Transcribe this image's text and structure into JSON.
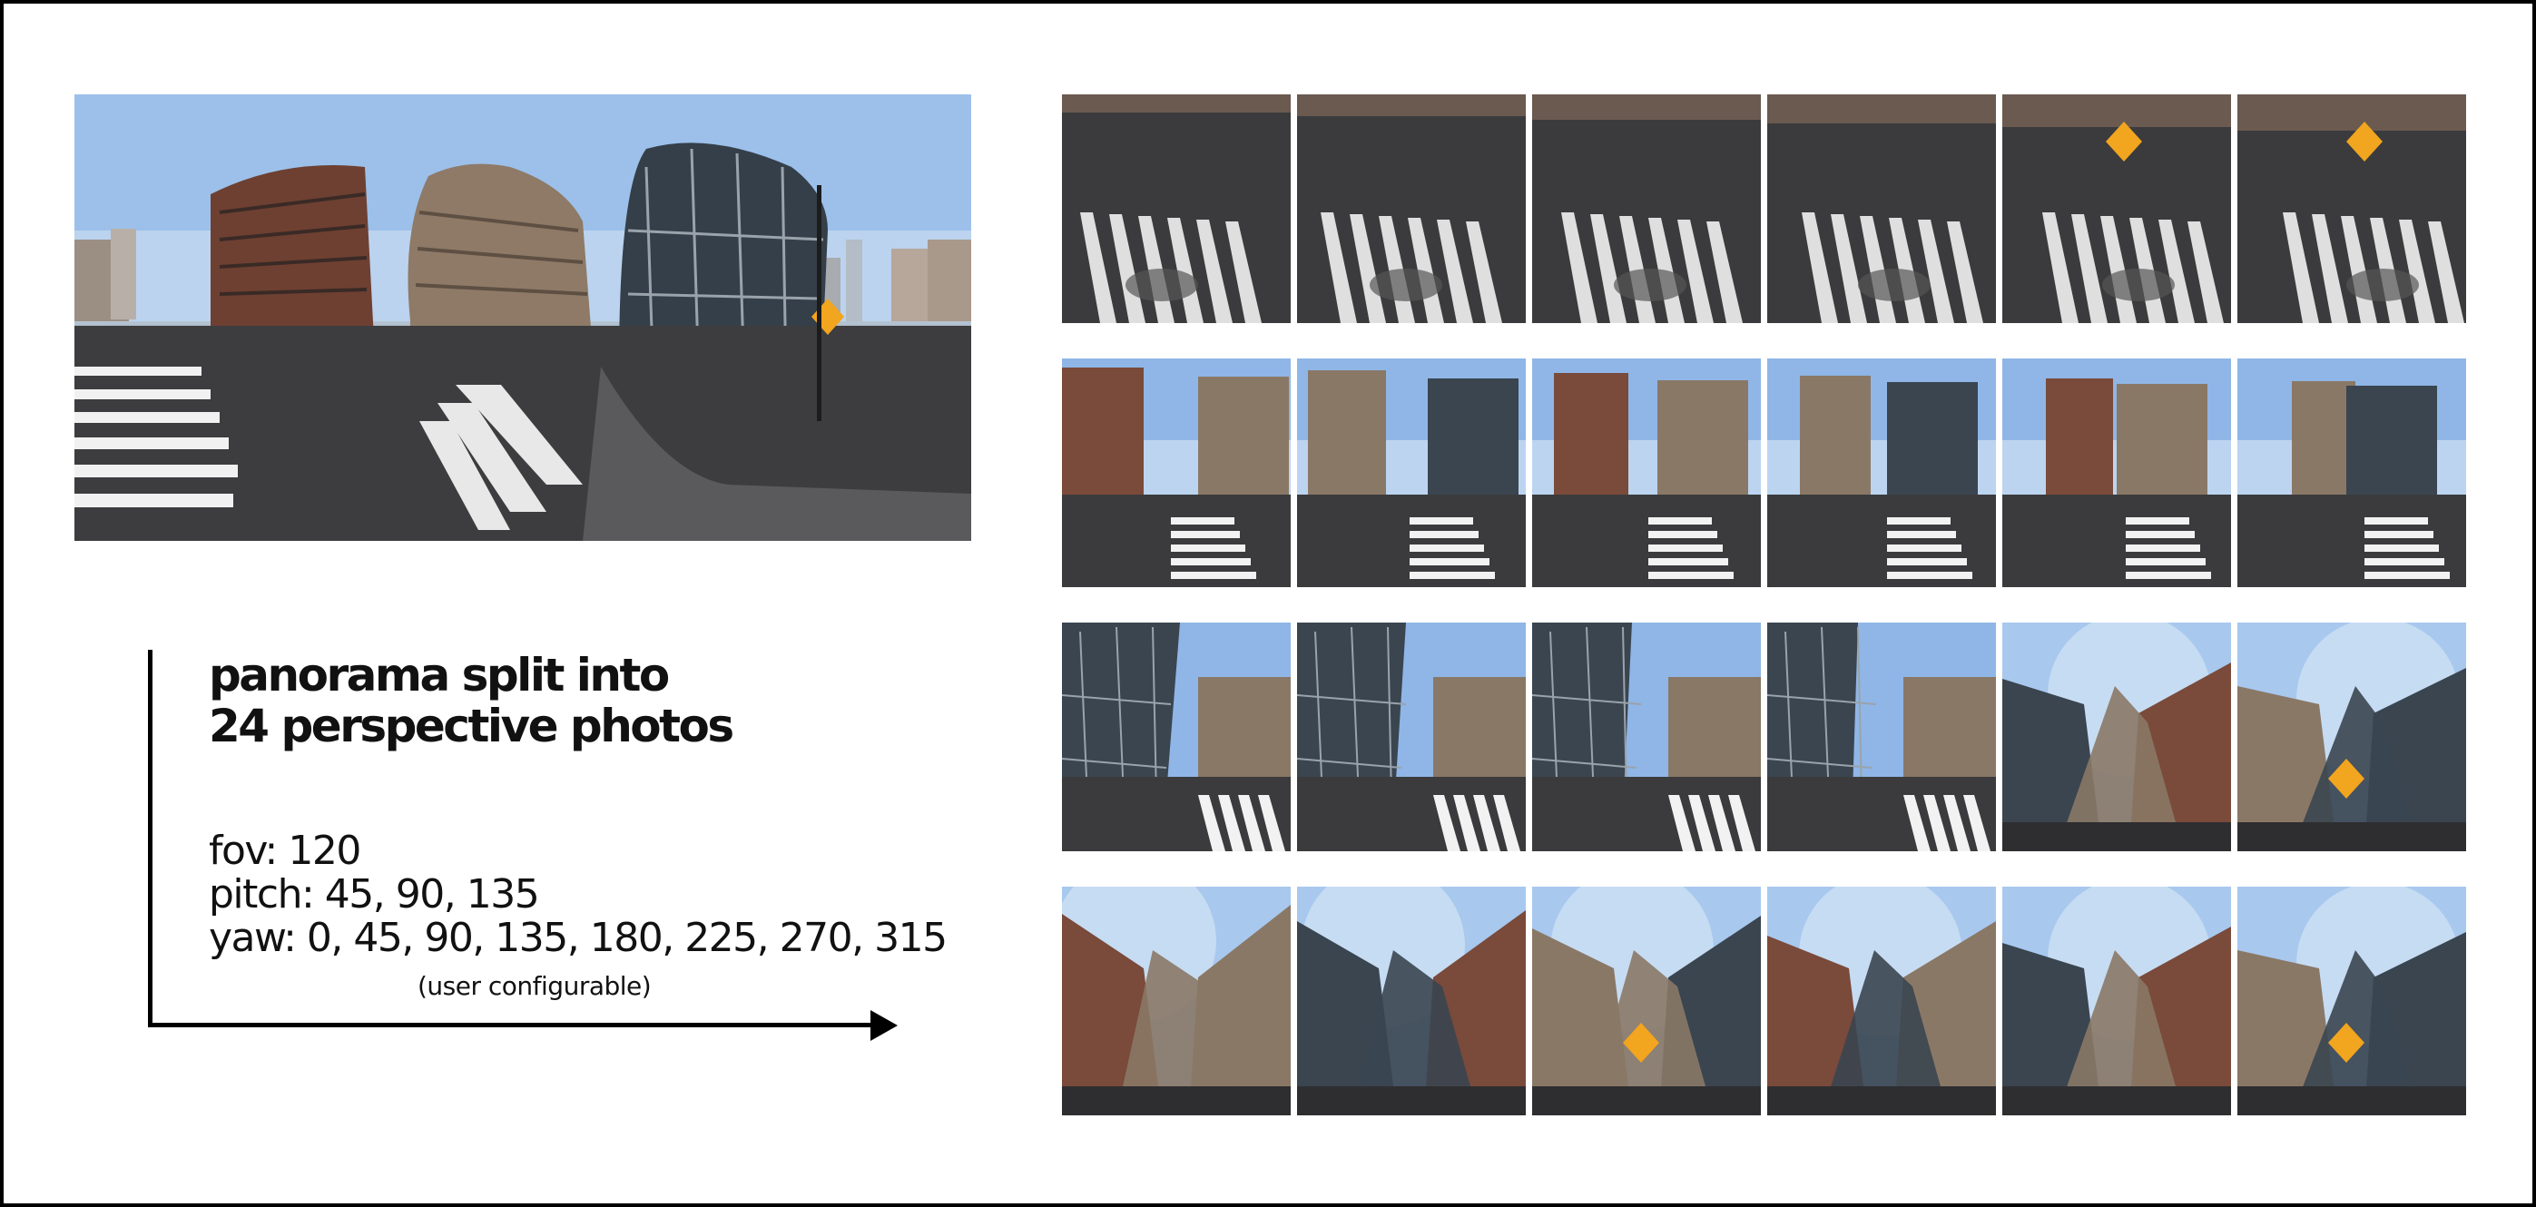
{
  "title": {
    "line1": "panorama split into",
    "line2": "24 perspective photos"
  },
  "params": {
    "fov": "fov: 120",
    "pitch": "pitch: 45, 90, 135",
    "yaw": "yaw: 0, 45, 90, 135, 180, 225, 270, 315",
    "note": "(user configurable)"
  },
  "grid": {
    "rows": 4,
    "cols": 6,
    "tiles": [
      {
        "style": "down"
      },
      {
        "style": "down"
      },
      {
        "style": "down"
      },
      {
        "style": "down"
      },
      {
        "style": "down"
      },
      {
        "style": "down"
      },
      {
        "style": "level"
      },
      {
        "style": "level"
      },
      {
        "style": "level"
      },
      {
        "style": "level"
      },
      {
        "style": "level"
      },
      {
        "style": "level"
      },
      {
        "style": "mixed"
      },
      {
        "style": "mixed"
      },
      {
        "style": "mixed"
      },
      {
        "style": "mixed"
      },
      {
        "style": "up"
      },
      {
        "style": "up"
      },
      {
        "style": "up"
      },
      {
        "style": "up"
      },
      {
        "style": "up"
      },
      {
        "style": "up"
      },
      {
        "style": "up"
      },
      {
        "style": "up"
      }
    ]
  },
  "colors": {
    "sky": "#8fb6e6",
    "sky_light": "#c7dcf2",
    "road": "#3b3b3d",
    "building_brick": "#7a4a3a",
    "building_stone": "#8a7866",
    "glass": "#3a4550",
    "crosswalk": "#f2f2f2",
    "sign": "#f2a51e",
    "frame": "#000000"
  }
}
